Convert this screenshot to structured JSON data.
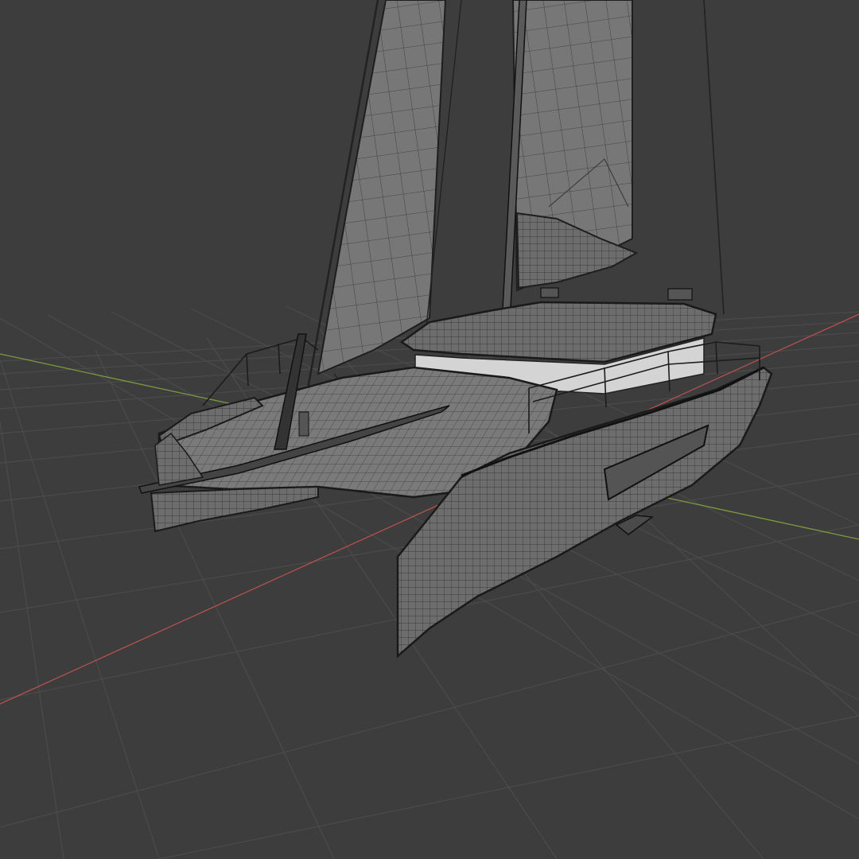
{
  "viewport": {
    "background": "#3d3d3d",
    "grid_color": "#4d4d4d",
    "axis_x_color": "#b65050",
    "axis_y_color": "#7c9a40"
  },
  "model": {
    "display_mode": "wireframe-overlay",
    "subject": "catamaran-sailboat-icon",
    "surface_color": "#6e6e6e",
    "wire_color": "#1c1c1c",
    "cabin_glass_color": "#d4d4d4"
  }
}
